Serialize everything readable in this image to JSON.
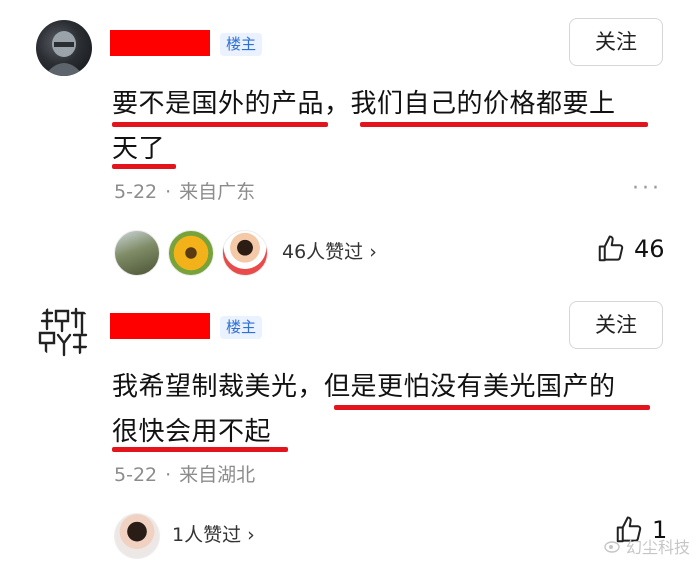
{
  "comments": [
    {
      "badge": "楼主",
      "follow_label": "关注",
      "text_line1": "要不是国外的产品，我们自己的价格都要上",
      "text_line2": "天了",
      "date": "5-22",
      "location": "来自广东",
      "likers_text": "46人赞过 ›",
      "like_count": "46"
    },
    {
      "badge": "楼主",
      "follow_label": "关注",
      "text_line1": "我希望制裁美光，但是更怕没有美光国产的",
      "text_line2": "很快会用不起",
      "date": "5-22",
      "location": "来自湖北",
      "likers_text": "1人赞过 ›",
      "like_count": "1"
    }
  ],
  "watermark": "幻尘科技",
  "colors": {
    "highlight_red": "#e4141c",
    "badge_blue": "#2f6fd6"
  }
}
